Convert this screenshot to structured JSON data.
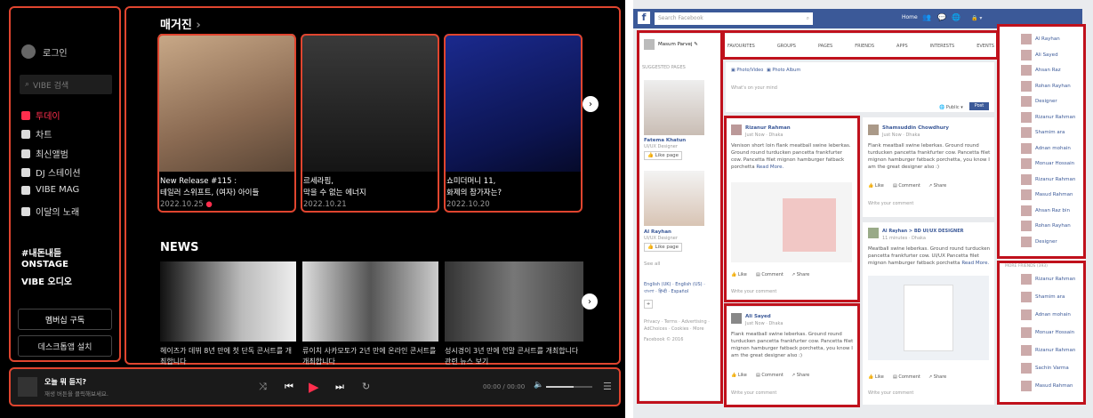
{
  "vibe": {
    "login": "로그인",
    "search_placeholder": "VIBE 검색",
    "nav": [
      {
        "label": "투데이",
        "active": true
      },
      {
        "label": "차트"
      },
      {
        "label": "최신앨범"
      },
      {
        "label": "DJ 스테이션"
      },
      {
        "label": "VIBE MAG"
      },
      {
        "label": "이달의 노래"
      }
    ],
    "sections": [
      "#내돈내듣",
      "ONSTAGE",
      "VIBE 오디오"
    ],
    "membership_button": "멤버십 구독",
    "desktop_button": "데스크톱앱 설치",
    "magazine_heading": "매거진",
    "magazine": [
      {
        "title1": "New Release #115 :",
        "title2": "테일러 스위프트, (여자) 아이들",
        "date": "2022.10.25",
        "new": true
      },
      {
        "title1": "르세라핌,",
        "title2": "막을 수 없는 에너지",
        "date": "2022.10.21"
      },
      {
        "title1": "쇼미더머니 11,",
        "title2": "화제의 참가자는?",
        "date": "2022.10.20"
      }
    ],
    "news_heading": "NEWS",
    "news": [
      {
        "text": "헤이즈가 데뷔 8년 만에 첫 단독 콘서트를 개최합니다"
      },
      {
        "text": "류이치 사카모토가 2년 만에 온라인 콘서트를 개최합니다"
      },
      {
        "text": "성시경이 3년 만에 연말 콘서트를 개최합니다 관련 뉴스 보기"
      }
    ],
    "player": {
      "title": "오늘 뭐 듣지?",
      "subtitle": "재생 버튼을 클릭해보세요.",
      "time": "00:00 / 00:00"
    },
    "accent": "#ff2e4d"
  },
  "fb": {
    "search_placeholder": "Search Facebook",
    "home": "Home",
    "user": "Masum Parvej",
    "tabs": [
      "FAVOURITES",
      "GROUPS",
      "PAGES",
      "FRIENDS",
      "APPS",
      "INTERESTS",
      "EVENTS"
    ],
    "suggested_heading": "SUGGESTED PAGES",
    "suggested": [
      {
        "name": "Fatema Khatun",
        "role": "UI/UX Designer",
        "like": "Like page"
      },
      {
        "name": "Al Rayhan",
        "role": "UI/UX Designer",
        "like": "Like page"
      }
    ],
    "see_all": "See all",
    "languages": "English (UK) · English (US) · বাংলা · हिन्दी · Español",
    "footer": "Privacy · Terms · Advertising · AdChoices · Cookies · More",
    "copyright": "Facebook © 2016",
    "composer": {
      "photo_video": "Photo/Video",
      "photo_album": "Photo Album",
      "placeholder": "What's on your mind",
      "privacy": "Public",
      "post": "Post"
    },
    "posts": [
      {
        "author": "Rizanur Rahman",
        "meta": "Just Now · Dhaka",
        "text": "Venison short loin flank meatball swine leberkas. Ground round turducken pancetta frankfurter cow. Pancetta filet mignon hamburger fatback porchetta",
        "more": "Read More."
      },
      {
        "author": "Shamsuddin Chowdhury",
        "meta": "Just Now · Dhaka",
        "text": "Flank meatball swine leberkas. Ground round turducken pancetta frankfurter cow. Pancetta filet mignon hamburger fatback porchetta, you know I am the great designer also :)"
      },
      {
        "author": "Al Rayhan > BD UI/UX DESIGNER",
        "meta": "11 minutes · Dhaka",
        "text": "Meatball swine leberkas. Ground round turducken pancetta frankfurter cow. UI/UX Pancetta filet mignon hamburger fatback porchetta",
        "more": "Read More."
      },
      {
        "author": "Ali Sayed",
        "meta": "Just Now · Dhaka",
        "text": "Flank meatball swine leberkas. Ground round turducken pancetta frankfurter cow. Pancetta filet mignon hamburger fatback porchetta, you know I am the great designer also :)"
      }
    ],
    "actions": {
      "like": "Like",
      "comment": "Comment",
      "share": "Share"
    },
    "comment_placeholder": "Write your comment",
    "friends": [
      "Al Rayhan",
      "Ali Sayed",
      "Ahsan Raz",
      "Rohan Rayhan",
      "Designer",
      "Rizanur Rahman",
      "Shamim ara",
      "Adnan mohain",
      "Monuar Hossain",
      "Rizanur Rahman",
      "Masud Rahman",
      "Ahsan Raz bin",
      "Rohan Rayhan",
      "Designer"
    ],
    "more_friends_heading": "MORE FRIENDS (393)",
    "more_friends": [
      "Rizanur Rahman",
      "Shamim ara",
      "Adnan mohain",
      "Monuar Hossain",
      "Rizanur Rahman",
      "Sachin Varma",
      "Masud Rahman"
    ],
    "brand": "#3b5998"
  }
}
